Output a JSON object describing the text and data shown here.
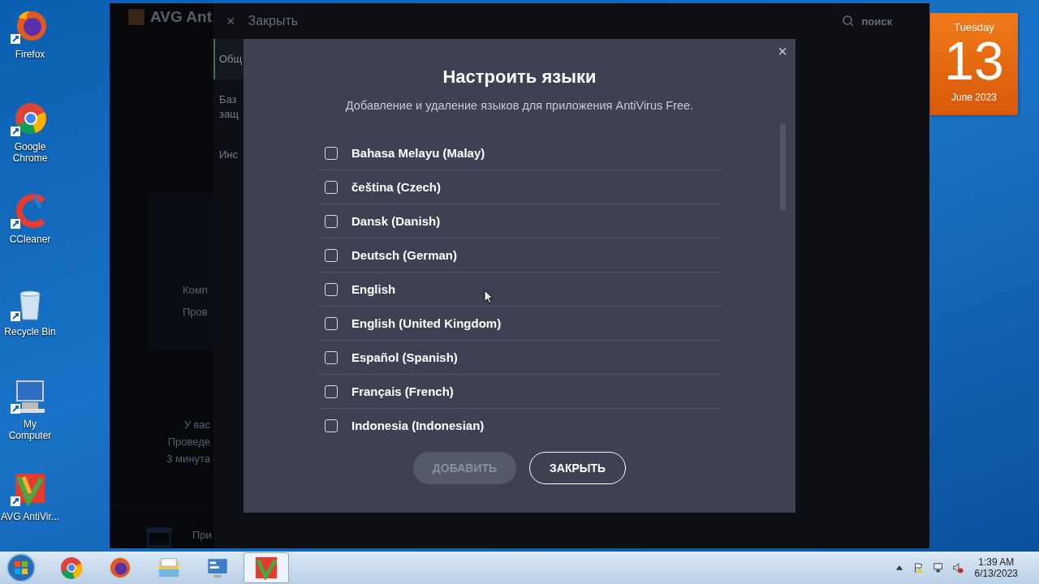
{
  "desktop_icons": [
    {
      "label": "Firefox",
      "kind": "firefox"
    },
    {
      "label": "Google Chrome",
      "kind": "chrome"
    },
    {
      "label": "CCleaner",
      "kind": "ccleaner"
    },
    {
      "label": "Recycle Bin",
      "kind": "bin"
    },
    {
      "label": "My Computer",
      "kind": "computer"
    },
    {
      "label": "AVG AntiVir...",
      "kind": "avg"
    }
  ],
  "app": {
    "title": "AVG Ant",
    "close_icon": "×",
    "close_label": "Закрыть",
    "search": "поиск",
    "sidebar": [
      {
        "label": "Общ",
        "selected": true
      },
      {
        "label": "Баз\nзащ",
        "selected": false
      },
      {
        "label": "Инс",
        "selected": false
      }
    ],
    "background_texts": [
      "Комп",
      "Пров",
      "У вас",
      "Проведе",
      "3 минута",
      "При"
    ]
  },
  "dialog": {
    "close_icon": "×",
    "title": "Настроить языки",
    "subtitle": "Добавление и удаление языков для приложения AntiVirus Free.",
    "languages": [
      {
        "label": "Bahasa Melayu (Malay)",
        "checked": false
      },
      {
        "label": "čeština (Czech)",
        "checked": false
      },
      {
        "label": "Dansk (Danish)",
        "checked": false
      },
      {
        "label": "Deutsch (German)",
        "checked": false
      },
      {
        "label": "English",
        "checked": false
      },
      {
        "label": "English (United Kingdom)",
        "checked": false
      },
      {
        "label": "Español (Spanish)",
        "checked": false
      },
      {
        "label": "Français (French)",
        "checked": false
      },
      {
        "label": "Indonesia (Indonesian)",
        "checked": false
      }
    ],
    "add_button": {
      "label": "ДОБАВИТЬ",
      "disabled": true
    },
    "close_button": {
      "label": "ЗАКРЫТЬ"
    }
  },
  "calendar": {
    "weekday": "Tuesday",
    "day": "13",
    "month": "June 2023"
  },
  "taskbar": {
    "apps": [
      {
        "kind": "chrome",
        "selected": false
      },
      {
        "kind": "firefox",
        "selected": false
      },
      {
        "kind": "explorer",
        "selected": false
      },
      {
        "kind": "control",
        "selected": false
      },
      {
        "kind": "avg",
        "selected": true
      }
    ],
    "time": "1:39 AM",
    "date": "6/13/2023"
  }
}
